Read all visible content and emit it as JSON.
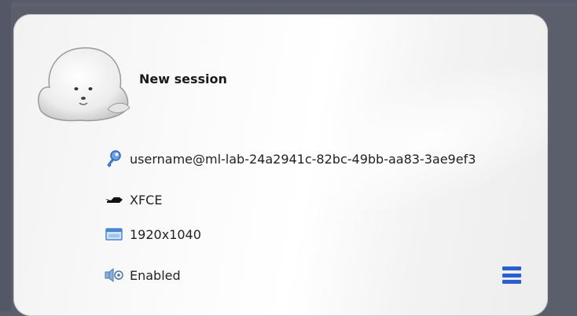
{
  "session": {
    "title": "New session",
    "user": "username@ml-lab-24a2941c-82bc-49bb-aa83-3ae9ef3",
    "desktop": "XFCE",
    "resolution": "1920x1040",
    "sound": "Enabled"
  },
  "icons": {
    "avatar": "seal-avatar-icon",
    "user": "key-icon",
    "desktop": "xfce-mouse-icon",
    "resolution": "display-icon",
    "sound": "speaker-icon",
    "menu": "hamburger-menu-icon"
  },
  "colors": {
    "accent": "#2b5fd0"
  }
}
